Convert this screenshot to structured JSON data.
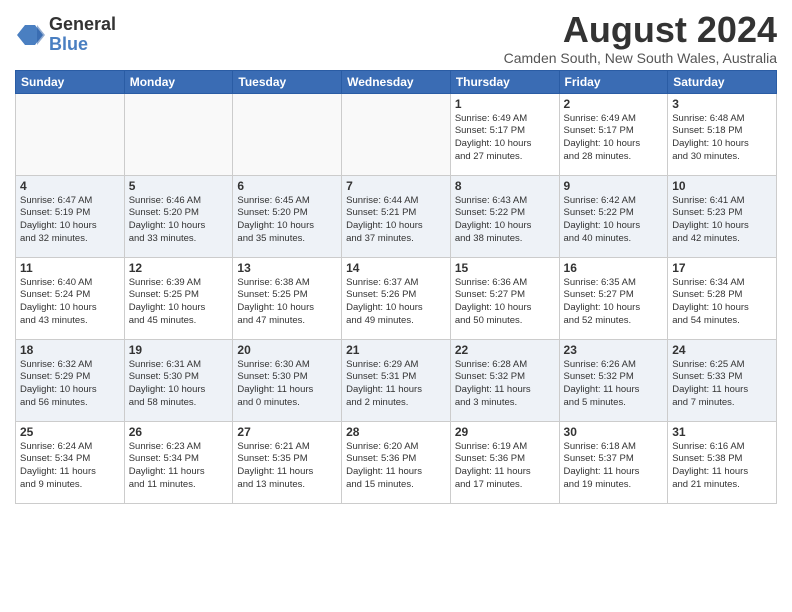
{
  "header": {
    "logo_line1": "General",
    "logo_line2": "Blue",
    "title": "August 2024",
    "subtitle": "Camden South, New South Wales, Australia"
  },
  "days": [
    "Sunday",
    "Monday",
    "Tuesday",
    "Wednesday",
    "Thursday",
    "Friday",
    "Saturday"
  ],
  "weeks": [
    [
      {
        "date": "",
        "content": ""
      },
      {
        "date": "",
        "content": ""
      },
      {
        "date": "",
        "content": ""
      },
      {
        "date": "",
        "content": ""
      },
      {
        "date": "1",
        "content": "Sunrise: 6:49 AM\nSunset: 5:17 PM\nDaylight: 10 hours\nand 27 minutes."
      },
      {
        "date": "2",
        "content": "Sunrise: 6:49 AM\nSunset: 5:17 PM\nDaylight: 10 hours\nand 28 minutes."
      },
      {
        "date": "3",
        "content": "Sunrise: 6:48 AM\nSunset: 5:18 PM\nDaylight: 10 hours\nand 30 minutes."
      }
    ],
    [
      {
        "date": "4",
        "content": "Sunrise: 6:47 AM\nSunset: 5:19 PM\nDaylight: 10 hours\nand 32 minutes."
      },
      {
        "date": "5",
        "content": "Sunrise: 6:46 AM\nSunset: 5:20 PM\nDaylight: 10 hours\nand 33 minutes."
      },
      {
        "date": "6",
        "content": "Sunrise: 6:45 AM\nSunset: 5:20 PM\nDaylight: 10 hours\nand 35 minutes."
      },
      {
        "date": "7",
        "content": "Sunrise: 6:44 AM\nSunset: 5:21 PM\nDaylight: 10 hours\nand 37 minutes."
      },
      {
        "date": "8",
        "content": "Sunrise: 6:43 AM\nSunset: 5:22 PM\nDaylight: 10 hours\nand 38 minutes."
      },
      {
        "date": "9",
        "content": "Sunrise: 6:42 AM\nSunset: 5:22 PM\nDaylight: 10 hours\nand 40 minutes."
      },
      {
        "date": "10",
        "content": "Sunrise: 6:41 AM\nSunset: 5:23 PM\nDaylight: 10 hours\nand 42 minutes."
      }
    ],
    [
      {
        "date": "11",
        "content": "Sunrise: 6:40 AM\nSunset: 5:24 PM\nDaylight: 10 hours\nand 43 minutes."
      },
      {
        "date": "12",
        "content": "Sunrise: 6:39 AM\nSunset: 5:25 PM\nDaylight: 10 hours\nand 45 minutes."
      },
      {
        "date": "13",
        "content": "Sunrise: 6:38 AM\nSunset: 5:25 PM\nDaylight: 10 hours\nand 47 minutes."
      },
      {
        "date": "14",
        "content": "Sunrise: 6:37 AM\nSunset: 5:26 PM\nDaylight: 10 hours\nand 49 minutes."
      },
      {
        "date": "15",
        "content": "Sunrise: 6:36 AM\nSunset: 5:27 PM\nDaylight: 10 hours\nand 50 minutes."
      },
      {
        "date": "16",
        "content": "Sunrise: 6:35 AM\nSunset: 5:27 PM\nDaylight: 10 hours\nand 52 minutes."
      },
      {
        "date": "17",
        "content": "Sunrise: 6:34 AM\nSunset: 5:28 PM\nDaylight: 10 hours\nand 54 minutes."
      }
    ],
    [
      {
        "date": "18",
        "content": "Sunrise: 6:32 AM\nSunset: 5:29 PM\nDaylight: 10 hours\nand 56 minutes."
      },
      {
        "date": "19",
        "content": "Sunrise: 6:31 AM\nSunset: 5:30 PM\nDaylight: 10 hours\nand 58 minutes."
      },
      {
        "date": "20",
        "content": "Sunrise: 6:30 AM\nSunset: 5:30 PM\nDaylight: 11 hours\nand 0 minutes."
      },
      {
        "date": "21",
        "content": "Sunrise: 6:29 AM\nSunset: 5:31 PM\nDaylight: 11 hours\nand 2 minutes."
      },
      {
        "date": "22",
        "content": "Sunrise: 6:28 AM\nSunset: 5:32 PM\nDaylight: 11 hours\nand 3 minutes."
      },
      {
        "date": "23",
        "content": "Sunrise: 6:26 AM\nSunset: 5:32 PM\nDaylight: 11 hours\nand 5 minutes."
      },
      {
        "date": "24",
        "content": "Sunrise: 6:25 AM\nSunset: 5:33 PM\nDaylight: 11 hours\nand 7 minutes."
      }
    ],
    [
      {
        "date": "25",
        "content": "Sunrise: 6:24 AM\nSunset: 5:34 PM\nDaylight: 11 hours\nand 9 minutes."
      },
      {
        "date": "26",
        "content": "Sunrise: 6:23 AM\nSunset: 5:34 PM\nDaylight: 11 hours\nand 11 minutes."
      },
      {
        "date": "27",
        "content": "Sunrise: 6:21 AM\nSunset: 5:35 PM\nDaylight: 11 hours\nand 13 minutes."
      },
      {
        "date": "28",
        "content": "Sunrise: 6:20 AM\nSunset: 5:36 PM\nDaylight: 11 hours\nand 15 minutes."
      },
      {
        "date": "29",
        "content": "Sunrise: 6:19 AM\nSunset: 5:36 PM\nDaylight: 11 hours\nand 17 minutes."
      },
      {
        "date": "30",
        "content": "Sunrise: 6:18 AM\nSunset: 5:37 PM\nDaylight: 11 hours\nand 19 minutes."
      },
      {
        "date": "31",
        "content": "Sunrise: 6:16 AM\nSunset: 5:38 PM\nDaylight: 11 hours\nand 21 minutes."
      }
    ]
  ]
}
